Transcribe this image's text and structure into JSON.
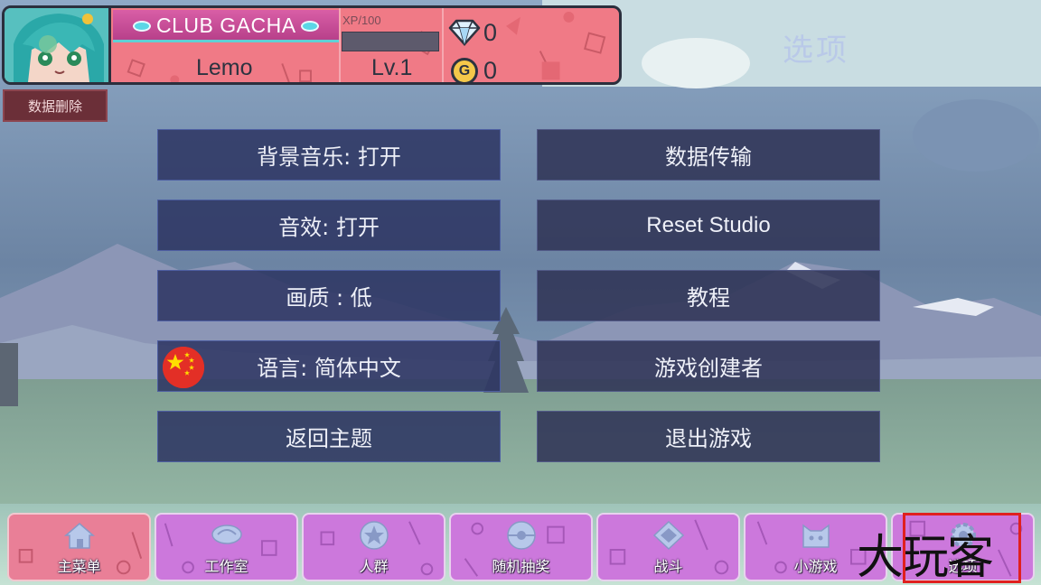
{
  "header": {
    "club_name": "CLUB GACHA",
    "player_name": "Lemo",
    "xp_label": "XP/100",
    "xp_fraction": 0.0,
    "level": "Lv.1",
    "gems": "0",
    "gold": "0",
    "coin_symbol": "G"
  },
  "page_title": "选项",
  "delete_data_label": "数据删除",
  "options": {
    "bgm": "背景音乐: 打开",
    "sfx": "音效: 打开",
    "quality": "画质 : 低",
    "language": "语言: 简体中文",
    "return_title": "返回主题",
    "data_transfer": "数据传输",
    "reset_studio": "Reset Studio",
    "tutorial": "教程",
    "credits": "游戏创建者",
    "exit_game": "退出游戏"
  },
  "nav": {
    "tabs": [
      {
        "label": "主菜单",
        "icon": "home-icon"
      },
      {
        "label": "工作室",
        "icon": "studio-icon"
      },
      {
        "label": "人群",
        "icon": "star-icon"
      },
      {
        "label": "随机抽奖",
        "icon": "gacha-ball-icon"
      },
      {
        "label": "战斗",
        "icon": "battle-icon"
      },
      {
        "label": "小游戏",
        "icon": "cat-icon"
      },
      {
        "label": "选项",
        "icon": "gear-icon"
      }
    ]
  },
  "watermark": "大玩客",
  "colors": {
    "card": "#f07a86",
    "club_bar": "#d95ea6",
    "option_button": "#2c3462",
    "nav_tab": "#cc78dc",
    "nav_tab_active": "#e97f97",
    "highlight": "#e0201f"
  }
}
